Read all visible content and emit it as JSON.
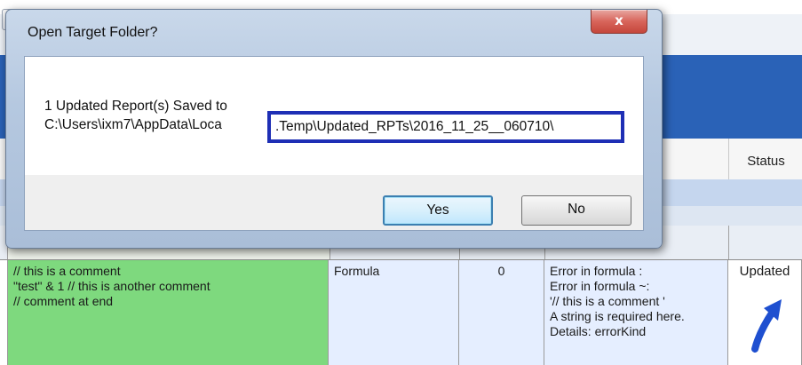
{
  "background": {
    "status_header": "Status",
    "row": {
      "formula_lines": [
        "// this is a comment",
        "\"test\" & 1 // this is another comment",
        "// comment at end"
      ],
      "type": "Formula",
      "count": "0",
      "error_lines": [
        "Error in formula :",
        "Error in formula  ~:",
        "'// this is a comment '",
        "A string is required here.",
        "Details: errorKind"
      ],
      "status": "Updated"
    },
    "colors": {
      "banner": "#2a62b7",
      "formula_cell": "#7ed97e",
      "arrow": "#1e4fd0"
    }
  },
  "dialog": {
    "title": "Open Target Folder?",
    "close_label": "x",
    "message_line1": "1 Updated Report(s) Saved to",
    "message_line2_prefix": "C:\\Users\\ixm7\\AppData\\Loca",
    "message_line2_highlight": ".Temp\\Updated_RPTs\\2016_11_25__060710\\",
    "yes_label": "Yes",
    "no_label": "No",
    "highlight_color": "#1e2fb5"
  }
}
